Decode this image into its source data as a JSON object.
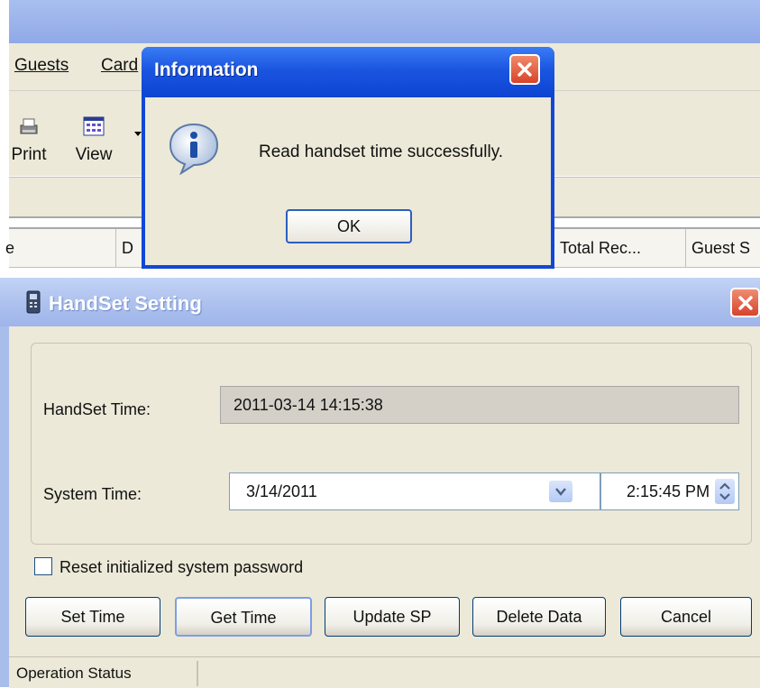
{
  "main_window": {
    "menu": [
      "Guests",
      "Card"
    ],
    "toolbar": {
      "print_label": "Print",
      "view_label": "View"
    },
    "grid_columns": [
      "e",
      "D",
      "Total Rec...",
      "Guest S"
    ]
  },
  "info_dialog": {
    "title": "Information",
    "message": "Read handset time successfully.",
    "ok_label": "OK",
    "icon": "information-icon"
  },
  "handset_dialog": {
    "title": "HandSet Setting",
    "handset_time_label": "HandSet Time:",
    "handset_time_value": "2011-03-14 14:15:38",
    "system_time_label": "System Time:",
    "system_date_value": "3/14/2011",
    "system_time_value": "2:15:45 PM",
    "reset_password_label": "Reset initialized system password",
    "reset_password_checked": false,
    "buttons": {
      "set_time": "Set Time",
      "get_time": "Get Time",
      "update_sp": "Update SP",
      "delete_data": "Delete Data",
      "cancel": "Cancel"
    },
    "status_text": "Operation Status"
  },
  "colors": {
    "xp_blue": "#0d44d2",
    "inactive_title": "#aec2ee",
    "close_red": "#d6432c",
    "dialog_face": "#ece9d8"
  }
}
